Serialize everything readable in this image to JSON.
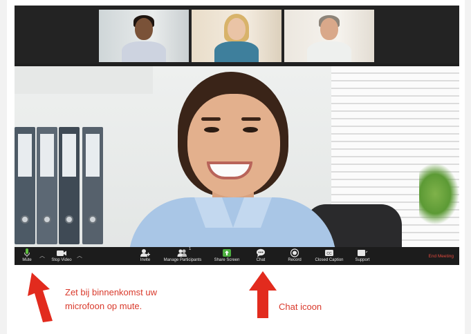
{
  "toolbar": {
    "mute_label": "Mute",
    "stop_video_label": "Stop Video",
    "invite_label": "Invite",
    "manage_participants_label": "Manage Participants",
    "participant_count": "1",
    "share_screen_label": "Share Screen",
    "chat_label": "Chat",
    "record_label": "Record",
    "closed_caption_label": "Closed Caption",
    "support_label": "Support",
    "end_meeting_label": "End Meeting"
  },
  "annotations": {
    "mute_note_line1": "Zet bij binnenkomst uw",
    "mute_note_line2": "microfoon op mute.",
    "chat_note": "Chat icoon"
  },
  "colors": {
    "annotation_red": "#d9392b",
    "share_green": "#4caf3f",
    "end_meeting_red": "#e0483d"
  },
  "icons": [
    "microphone-icon",
    "video-camera-icon",
    "invite-icon",
    "participants-icon",
    "share-screen-icon",
    "chat-bubble-icon",
    "record-icon",
    "closed-caption-icon",
    "support-icon"
  ]
}
